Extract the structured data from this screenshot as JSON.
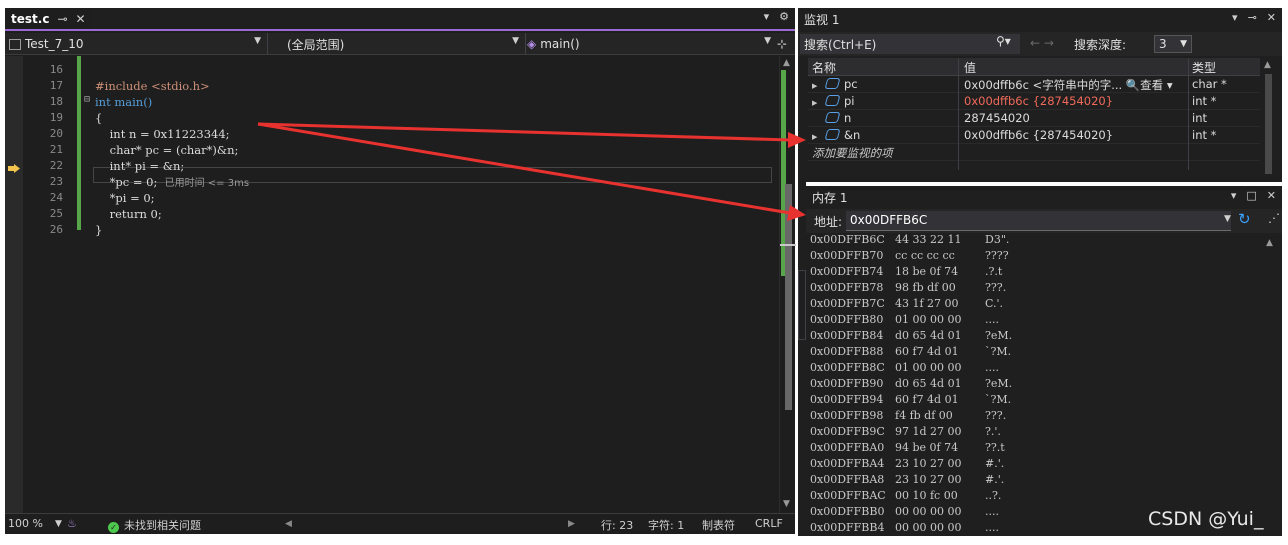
{
  "editor": {
    "tab": {
      "title": "test.c",
      "pin_icon": "pin-icon",
      "close_icon": "close-icon"
    },
    "tabbar_right": {
      "dropdown": "▾",
      "settings": "⚙"
    },
    "nav": {
      "project": "Test_7_10",
      "scope": "(全局范围)",
      "function": "main()",
      "split": "⊹"
    },
    "lines": [
      {
        "no": "16",
        "code": ""
      },
      {
        "no": "17",
        "code": "#include <stdio.h>"
      },
      {
        "no": "18",
        "code": "int main()"
      },
      {
        "no": "19",
        "code": "{"
      },
      {
        "no": "20",
        "code": "    int n = 0x11223344;"
      },
      {
        "no": "21",
        "code": "    char* pc = (char*)&n;"
      },
      {
        "no": "22",
        "code": "    int* pi = &n;"
      },
      {
        "no": "23",
        "code": "    *pc = 0;"
      },
      {
        "no": "24",
        "code": "    *pi = 0;"
      },
      {
        "no": "25",
        "code": "    return 0;"
      },
      {
        "no": "26",
        "code": "}"
      }
    ],
    "elapsed": "已用时间 <= 3ms",
    "status": {
      "zoom": "100 %",
      "issues": "未找到相关问题",
      "line": "行: 23",
      "char": "字符: 1",
      "tabs": "制表符",
      "eol": "CRLF"
    }
  },
  "watch": {
    "title": "监视 1",
    "search_placeholder": "搜索(Ctrl+E)",
    "search_depth_label": "搜索深度:",
    "search_depth": "3",
    "columns": [
      "名称",
      "值",
      "类型"
    ],
    "rows": [
      {
        "name": "pc",
        "value": "0x00dffb6c <字符串中的字...",
        "view": "🔍查看 ▾",
        "type": "char *",
        "changed": false
      },
      {
        "name": "pi",
        "value": "0x00dffb6c {287454020}",
        "view": "",
        "type": "int *",
        "changed": true
      },
      {
        "name": "n",
        "value": "287454020",
        "view": "",
        "type": "int",
        "changed": false
      },
      {
        "name": "&n",
        "value": "0x00dffb6c {287454020}",
        "view": "",
        "type": "int *",
        "changed": false
      }
    ],
    "add_watch": "添加要监视的项"
  },
  "memory": {
    "title": "内存 1",
    "address_label": "地址:",
    "address": "0x00DFFB6C",
    "rows": [
      {
        "addr": "0x00DFFB6C",
        "hex": "44 33 22 11",
        "ascii": "D3\"."
      },
      {
        "addr": "0x00DFFB70",
        "hex": "cc cc cc cc",
        "ascii": "????"
      },
      {
        "addr": "0x00DFFB74",
        "hex": "18 be 0f 74",
        "ascii": ".?.t"
      },
      {
        "addr": "0x00DFFB78",
        "hex": "98 fb df 00",
        "ascii": "???."
      },
      {
        "addr": "0x00DFFB7C",
        "hex": "43 1f 27 00",
        "ascii": "C.'."
      },
      {
        "addr": "0x00DFFB80",
        "hex": "01 00 00 00",
        "ascii": "...."
      },
      {
        "addr": "0x00DFFB84",
        "hex": "d0 65 4d 01",
        "ascii": "?eM."
      },
      {
        "addr": "0x00DFFB88",
        "hex": "60 f7 4d 01",
        "ascii": "`?M."
      },
      {
        "addr": "0x00DFFB8C",
        "hex": "01 00 00 00",
        "ascii": "...."
      },
      {
        "addr": "0x00DFFB90",
        "hex": "d0 65 4d 01",
        "ascii": "?eM."
      },
      {
        "addr": "0x00DFFB94",
        "hex": "60 f7 4d 01",
        "ascii": "`?M."
      },
      {
        "addr": "0x00DFFB98",
        "hex": "f4 fb df 00",
        "ascii": "???."
      },
      {
        "addr": "0x00DFFB9C",
        "hex": "97 1d 27 00",
        "ascii": "?.'."
      },
      {
        "addr": "0x00DFFBA0",
        "hex": "94 be 0f 74",
        "ascii": "??.t"
      },
      {
        "addr": "0x00DFFBA4",
        "hex": "23 10 27 00",
        "ascii": "#.'."
      },
      {
        "addr": "0x00DFFBA8",
        "hex": "23 10 27 00",
        "ascii": "#.'."
      },
      {
        "addr": "0x00DFFBAC",
        "hex": "00 10 fc 00",
        "ascii": "..?."
      },
      {
        "addr": "0x00DFFBB0",
        "hex": "00 00 00 00",
        "ascii": "...."
      },
      {
        "addr": "0x00DFFBB4",
        "hex": "00 00 00 00",
        "ascii": "...."
      }
    ]
  },
  "watermark": "CSDN @Yui_",
  "colors": {
    "accent": "#9b6ad6",
    "changed_value": "#f06a5a",
    "annotation_arrow": "#e8322f",
    "gutter_green": "#57a64a"
  }
}
